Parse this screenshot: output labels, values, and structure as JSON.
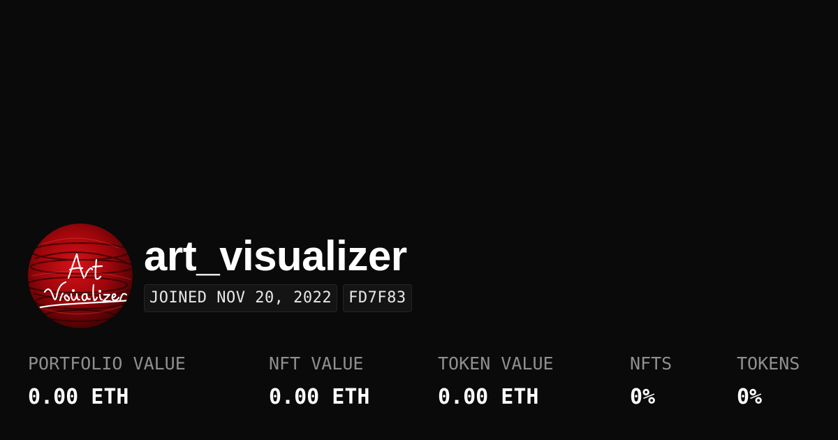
{
  "profile": {
    "username": "art_visualizer",
    "avatar_icon": "art-visualizer-logo",
    "avatar_logo_text_line1": "Art",
    "avatar_logo_text_line2": "Visualizer",
    "joined": "JOINED NOV 20, 2022",
    "address_tag": "FD7F83"
  },
  "stats": [
    {
      "label": "PORTFOLIO VALUE",
      "value": "0.00 ETH"
    },
    {
      "label": "NFT VALUE",
      "value": "0.00 ETH"
    },
    {
      "label": "TOKEN VALUE",
      "value": "0.00 ETH"
    },
    {
      "label": "NFTS",
      "value": "0%"
    },
    {
      "label": "TOKENS",
      "value": "0%"
    }
  ],
  "colors": {
    "background": "#0a0a0a",
    "text_primary": "#ffffff",
    "text_muted": "#8f8f8f",
    "chip_background": "#141414",
    "avatar_red": "#b3070d"
  }
}
